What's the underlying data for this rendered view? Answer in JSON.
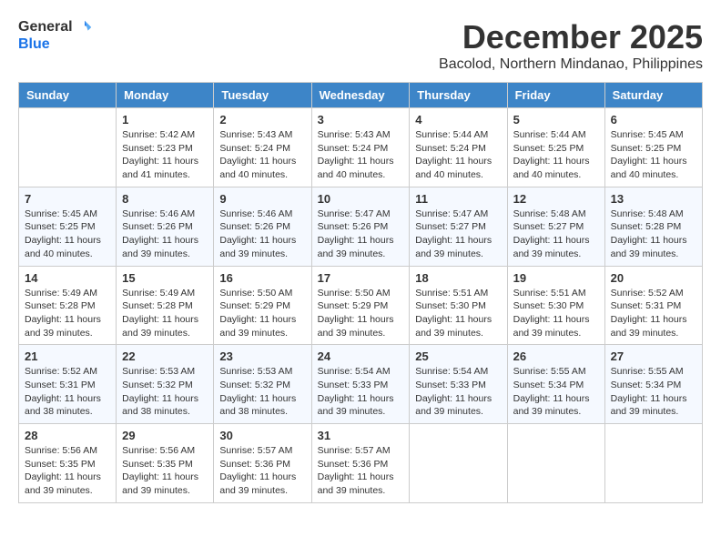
{
  "logo": {
    "line1": "General",
    "line2": "Blue"
  },
  "title": "December 2025",
  "location": "Bacolod, Northern Mindanao, Philippines",
  "days_of_week": [
    "Sunday",
    "Monday",
    "Tuesday",
    "Wednesday",
    "Thursday",
    "Friday",
    "Saturday"
  ],
  "weeks": [
    [
      {
        "day": "",
        "sunrise": "",
        "sunset": "",
        "daylight": ""
      },
      {
        "day": "1",
        "sunrise": "Sunrise: 5:42 AM",
        "sunset": "Sunset: 5:23 PM",
        "daylight": "Daylight: 11 hours and 41 minutes."
      },
      {
        "day": "2",
        "sunrise": "Sunrise: 5:43 AM",
        "sunset": "Sunset: 5:24 PM",
        "daylight": "Daylight: 11 hours and 40 minutes."
      },
      {
        "day": "3",
        "sunrise": "Sunrise: 5:43 AM",
        "sunset": "Sunset: 5:24 PM",
        "daylight": "Daylight: 11 hours and 40 minutes."
      },
      {
        "day": "4",
        "sunrise": "Sunrise: 5:44 AM",
        "sunset": "Sunset: 5:24 PM",
        "daylight": "Daylight: 11 hours and 40 minutes."
      },
      {
        "day": "5",
        "sunrise": "Sunrise: 5:44 AM",
        "sunset": "Sunset: 5:25 PM",
        "daylight": "Daylight: 11 hours and 40 minutes."
      },
      {
        "day": "6",
        "sunrise": "Sunrise: 5:45 AM",
        "sunset": "Sunset: 5:25 PM",
        "daylight": "Daylight: 11 hours and 40 minutes."
      }
    ],
    [
      {
        "day": "7",
        "sunrise": "Sunrise: 5:45 AM",
        "sunset": "Sunset: 5:25 PM",
        "daylight": "Daylight: 11 hours and 40 minutes."
      },
      {
        "day": "8",
        "sunrise": "Sunrise: 5:46 AM",
        "sunset": "Sunset: 5:26 PM",
        "daylight": "Daylight: 11 hours and 39 minutes."
      },
      {
        "day": "9",
        "sunrise": "Sunrise: 5:46 AM",
        "sunset": "Sunset: 5:26 PM",
        "daylight": "Daylight: 11 hours and 39 minutes."
      },
      {
        "day": "10",
        "sunrise": "Sunrise: 5:47 AM",
        "sunset": "Sunset: 5:26 PM",
        "daylight": "Daylight: 11 hours and 39 minutes."
      },
      {
        "day": "11",
        "sunrise": "Sunrise: 5:47 AM",
        "sunset": "Sunset: 5:27 PM",
        "daylight": "Daylight: 11 hours and 39 minutes."
      },
      {
        "day": "12",
        "sunrise": "Sunrise: 5:48 AM",
        "sunset": "Sunset: 5:27 PM",
        "daylight": "Daylight: 11 hours and 39 minutes."
      },
      {
        "day": "13",
        "sunrise": "Sunrise: 5:48 AM",
        "sunset": "Sunset: 5:28 PM",
        "daylight": "Daylight: 11 hours and 39 minutes."
      }
    ],
    [
      {
        "day": "14",
        "sunrise": "Sunrise: 5:49 AM",
        "sunset": "Sunset: 5:28 PM",
        "daylight": "Daylight: 11 hours and 39 minutes."
      },
      {
        "day": "15",
        "sunrise": "Sunrise: 5:49 AM",
        "sunset": "Sunset: 5:28 PM",
        "daylight": "Daylight: 11 hours and 39 minutes."
      },
      {
        "day": "16",
        "sunrise": "Sunrise: 5:50 AM",
        "sunset": "Sunset: 5:29 PM",
        "daylight": "Daylight: 11 hours and 39 minutes."
      },
      {
        "day": "17",
        "sunrise": "Sunrise: 5:50 AM",
        "sunset": "Sunset: 5:29 PM",
        "daylight": "Daylight: 11 hours and 39 minutes."
      },
      {
        "day": "18",
        "sunrise": "Sunrise: 5:51 AM",
        "sunset": "Sunset: 5:30 PM",
        "daylight": "Daylight: 11 hours and 39 minutes."
      },
      {
        "day": "19",
        "sunrise": "Sunrise: 5:51 AM",
        "sunset": "Sunset: 5:30 PM",
        "daylight": "Daylight: 11 hours and 39 minutes."
      },
      {
        "day": "20",
        "sunrise": "Sunrise: 5:52 AM",
        "sunset": "Sunset: 5:31 PM",
        "daylight": "Daylight: 11 hours and 39 minutes."
      }
    ],
    [
      {
        "day": "21",
        "sunrise": "Sunrise: 5:52 AM",
        "sunset": "Sunset: 5:31 PM",
        "daylight": "Daylight: 11 hours and 38 minutes."
      },
      {
        "day": "22",
        "sunrise": "Sunrise: 5:53 AM",
        "sunset": "Sunset: 5:32 PM",
        "daylight": "Daylight: 11 hours and 38 minutes."
      },
      {
        "day": "23",
        "sunrise": "Sunrise: 5:53 AM",
        "sunset": "Sunset: 5:32 PM",
        "daylight": "Daylight: 11 hours and 38 minutes."
      },
      {
        "day": "24",
        "sunrise": "Sunrise: 5:54 AM",
        "sunset": "Sunset: 5:33 PM",
        "daylight": "Daylight: 11 hours and 39 minutes."
      },
      {
        "day": "25",
        "sunrise": "Sunrise: 5:54 AM",
        "sunset": "Sunset: 5:33 PM",
        "daylight": "Daylight: 11 hours and 39 minutes."
      },
      {
        "day": "26",
        "sunrise": "Sunrise: 5:55 AM",
        "sunset": "Sunset: 5:34 PM",
        "daylight": "Daylight: 11 hours and 39 minutes."
      },
      {
        "day": "27",
        "sunrise": "Sunrise: 5:55 AM",
        "sunset": "Sunset: 5:34 PM",
        "daylight": "Daylight: 11 hours and 39 minutes."
      }
    ],
    [
      {
        "day": "28",
        "sunrise": "Sunrise: 5:56 AM",
        "sunset": "Sunset: 5:35 PM",
        "daylight": "Daylight: 11 hours and 39 minutes."
      },
      {
        "day": "29",
        "sunrise": "Sunrise: 5:56 AM",
        "sunset": "Sunset: 5:35 PM",
        "daylight": "Daylight: 11 hours and 39 minutes."
      },
      {
        "day": "30",
        "sunrise": "Sunrise: 5:57 AM",
        "sunset": "Sunset: 5:36 PM",
        "daylight": "Daylight: 11 hours and 39 minutes."
      },
      {
        "day": "31",
        "sunrise": "Sunrise: 5:57 AM",
        "sunset": "Sunset: 5:36 PM",
        "daylight": "Daylight: 11 hours and 39 minutes."
      },
      {
        "day": "",
        "sunrise": "",
        "sunset": "",
        "daylight": ""
      },
      {
        "day": "",
        "sunrise": "",
        "sunset": "",
        "daylight": ""
      },
      {
        "day": "",
        "sunrise": "",
        "sunset": "",
        "daylight": ""
      }
    ]
  ]
}
